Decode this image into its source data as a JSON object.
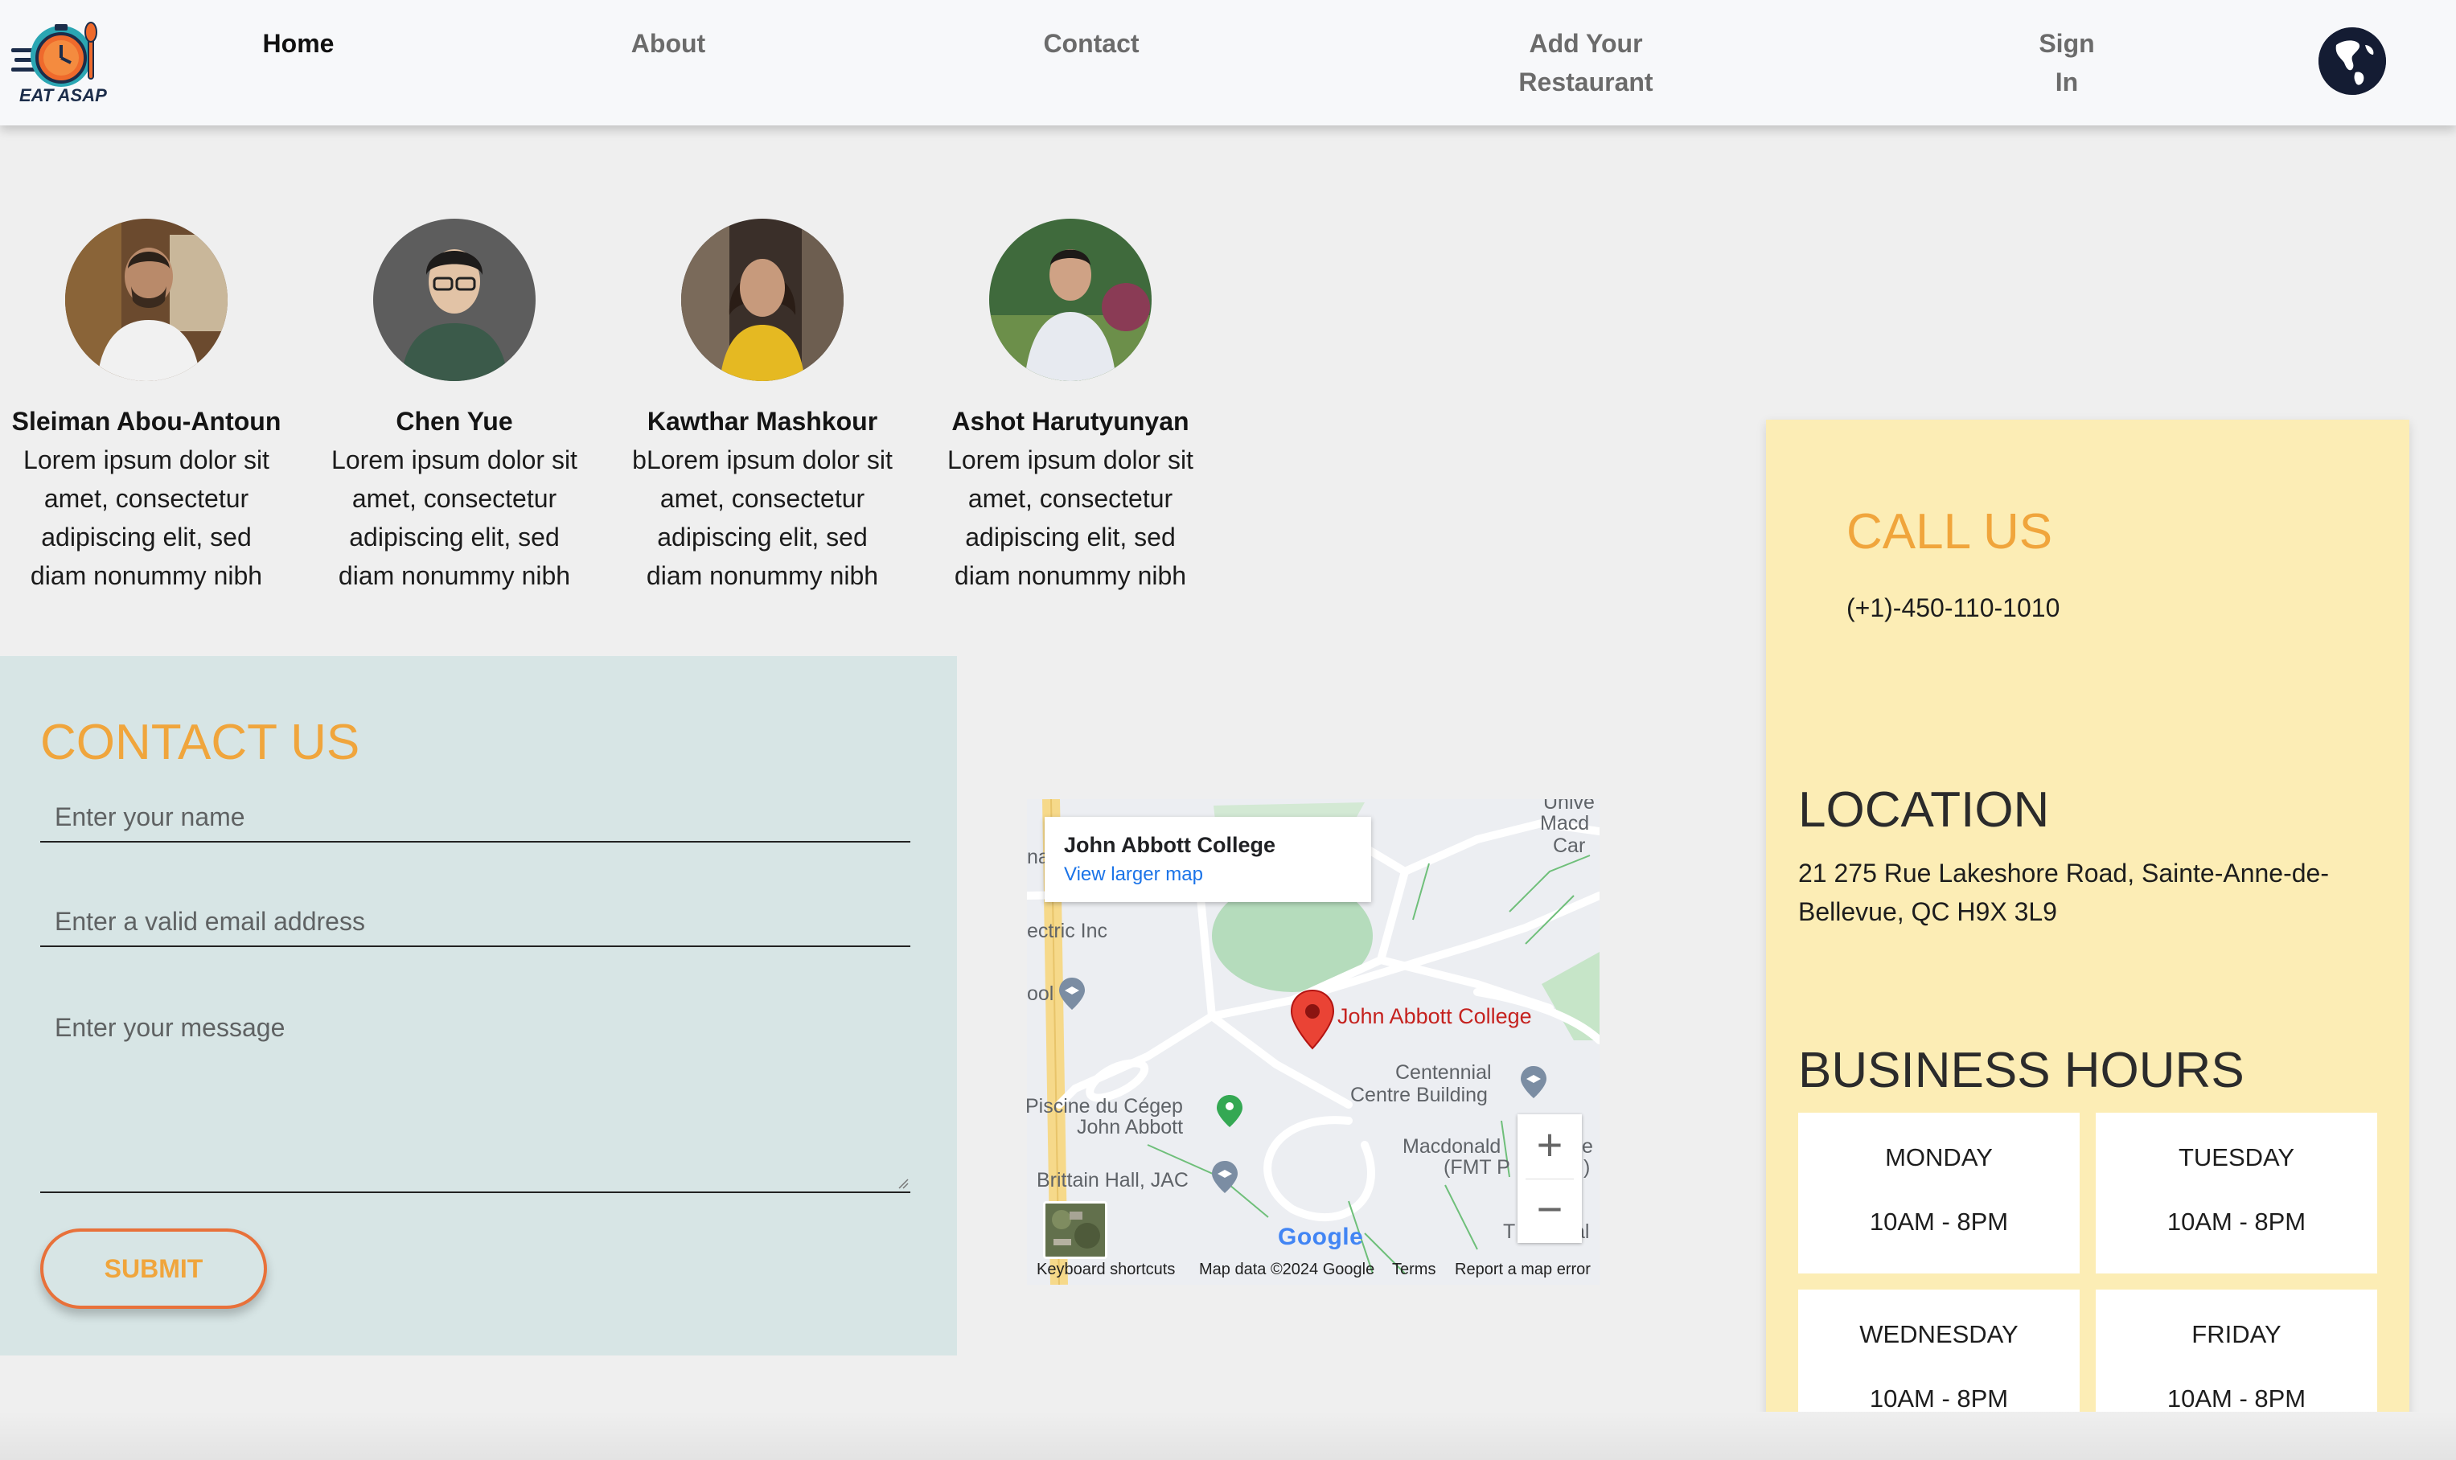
{
  "nav": {
    "logo_text": "EAT ASAP",
    "links": [
      {
        "label": "Home",
        "active": true
      },
      {
        "label": "About",
        "active": false
      },
      {
        "label": "Contact",
        "active": false
      },
      {
        "label": "Add Your Restaurant",
        "line1": "Add Your",
        "line2": "Restaurant",
        "active": false
      },
      {
        "label": "Sign In",
        "line1": "Sign",
        "line2": "In",
        "active": false
      }
    ],
    "language_icon": "globe-icon"
  },
  "team": [
    {
      "name": "Sleiman Abou-Antoun",
      "bio": [
        "Lorem ipsum dolor sit",
        "amet, consectetur",
        "adipiscing elit, sed",
        "diam nonummy nibh"
      ]
    },
    {
      "name": "Chen Yue",
      "bio": [
        "Lorem ipsum dolor sit",
        "amet, consectetur",
        "adipiscing elit, sed",
        "diam nonummy nibh"
      ]
    },
    {
      "name": "Kawthar Mashkour",
      "bio": [
        "bLorem ipsum dolor sit",
        "amet, consectetur",
        "adipiscing elit, sed",
        "diam nonummy nibh"
      ]
    },
    {
      "name": "Ashot Harutyunyan",
      "bio": [
        "Lorem ipsum dolor sit",
        "amet, consectetur",
        "adipiscing elit, sed",
        "diam nonummy nibh"
      ]
    }
  ],
  "contact": {
    "title": "CONTACT US",
    "name_placeholder": "Enter your name",
    "email_placeholder": "Enter a valid email address",
    "message_placeholder": "Enter your message",
    "submit_label": "SUBMIT"
  },
  "map": {
    "place_name": "John Abbott College",
    "view_larger": "View larger map",
    "marker_label": "John Abbott College",
    "labels": {
      "electric": "ectric Inc",
      "pool": "ool",
      "univ1": "Unive",
      "univ2": "Macd",
      "univ3": "Car",
      "na": "na",
      "piscine1": "Piscine du Cégep",
      "piscine2": "John Abbott",
      "centennial1": "Centennial",
      "centennial2": "Centre Building",
      "macdonald1": "Macdonald",
      "macdonald2": "(FMT P",
      "brittain": "Brittain Hall, JAC",
      "edge_e": "e",
      "edge_paren": ")",
      "edge_t": "T",
      "edge_al": "al"
    },
    "zoom_in": "+",
    "zoom_out": "−",
    "google": "Google",
    "footer": {
      "shortcuts": "Keyboard shortcuts",
      "data": "Map data ©2024 Google",
      "terms": "Terms",
      "report": "Report a map error"
    }
  },
  "info": {
    "call_title": "CALL US",
    "phone": "(+1)-450-110-1010",
    "location_title": "LOCATION",
    "address_line1": "21 275 Rue Lakeshore Road, Sainte-Anne-de-",
    "address_line2": "Bellevue, QC H9X 3L9",
    "hours_title": "BUSINESS HOURS",
    "hours": [
      {
        "day": "MONDAY",
        "time": "10AM - 8PM"
      },
      {
        "day": "TUESDAY",
        "time": "10AM - 8PM"
      },
      {
        "day": "WEDNESDAY",
        "time": "10AM - 8PM"
      },
      {
        "day": "FRIDAY",
        "time": "10AM - 8PM"
      }
    ]
  },
  "colors": {
    "accent_orange": "#f0a53c",
    "button_border": "#e8713a",
    "contact_bg": "#d7e5e5",
    "info_bg": "#fcedb5",
    "page_bg": "#efefef"
  }
}
